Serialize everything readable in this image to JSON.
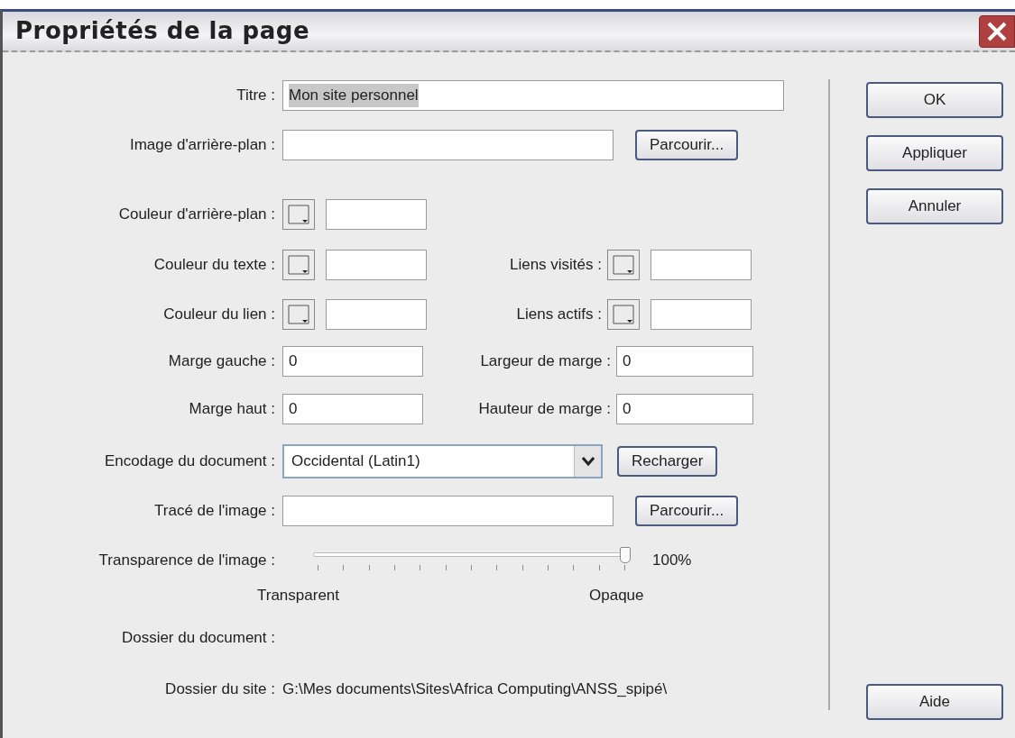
{
  "window": {
    "title": "Propriétés de la page"
  },
  "rows": [
    {
      "kind": "text",
      "label": "Titre :",
      "value": "Mon site personnel",
      "highlighted": true
    },
    {
      "kind": "browse",
      "label": "Image d'arrière-plan :",
      "button": "Parcourir..."
    },
    {
      "kind": "color",
      "label": "Couleur d'arrière-plan :"
    },
    {
      "kind": "color2",
      "label": "Couleur du texte :",
      "label2": "Liens visités :"
    },
    {
      "kind": "color2",
      "label": "Couleur du lien :",
      "label2": "Liens actifs :"
    },
    {
      "kind": "number2",
      "label": "Marge gauche :",
      "value": "0",
      "label2": "Largeur de marge :",
      "value2": "0"
    },
    {
      "kind": "number2",
      "label": "Marge haut :",
      "value": "0",
      "label2": "Hauteur de marge :",
      "value2": "0"
    },
    {
      "kind": "select",
      "label": "Encodage du document :",
      "value": "Occidental (Latin1)",
      "button": "Recharger"
    },
    {
      "kind": "browse",
      "label": "Tracé de l'image :",
      "button": "Parcourir..."
    },
    {
      "kind": "slider",
      "label": "Transparence de l'image :",
      "level": 1,
      "reading": "100%",
      "min_label": "Transparent",
      "max_label": "Opaque"
    },
    {
      "kind": "info",
      "label": "Dossier du document :"
    },
    {
      "kind": "info",
      "label": "Dossier du site :",
      "value": "G:\\Mes documents\\Sites\\Africa Computing\\ANSS_spipé\\"
    }
  ],
  "buttons": [
    "OK",
    "Appliquer",
    "Annuler"
  ],
  "help_button": "Aide"
}
